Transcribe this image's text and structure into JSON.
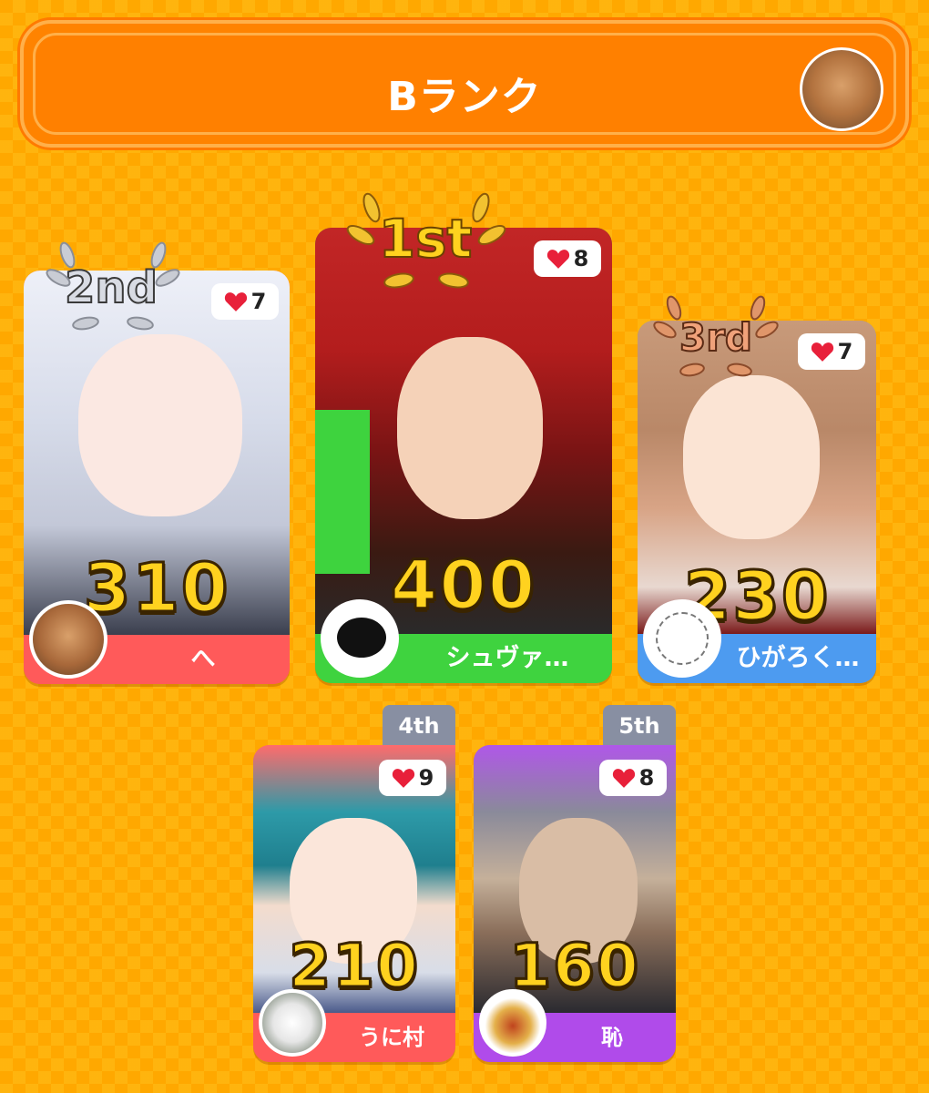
{
  "header": {
    "title": "Bランク",
    "avatar_icon": "cat-avatar-icon"
  },
  "ranks": [
    {
      "place": "1st",
      "likes": "8",
      "score": "400",
      "user": "シュヴァ…",
      "card_color": "#3fd33f"
    },
    {
      "place": "2nd",
      "likes": "7",
      "score": "310",
      "user": "へ",
      "card_color": "#ff5a5a"
    },
    {
      "place": "3rd",
      "likes": "7",
      "score": "230",
      "user": "ひがろく…",
      "card_color": "#4d9bf0"
    },
    {
      "place": "4th",
      "likes": "9",
      "score": "210",
      "user": "うに村",
      "card_color": "#ff5a5a"
    },
    {
      "place": "5th",
      "likes": "8",
      "score": "160",
      "user": "恥",
      "card_color": "#b04bea"
    }
  ],
  "colors": {
    "accent": "#ff8000",
    "background": "#ffa800",
    "heart": "#e8203a"
  }
}
